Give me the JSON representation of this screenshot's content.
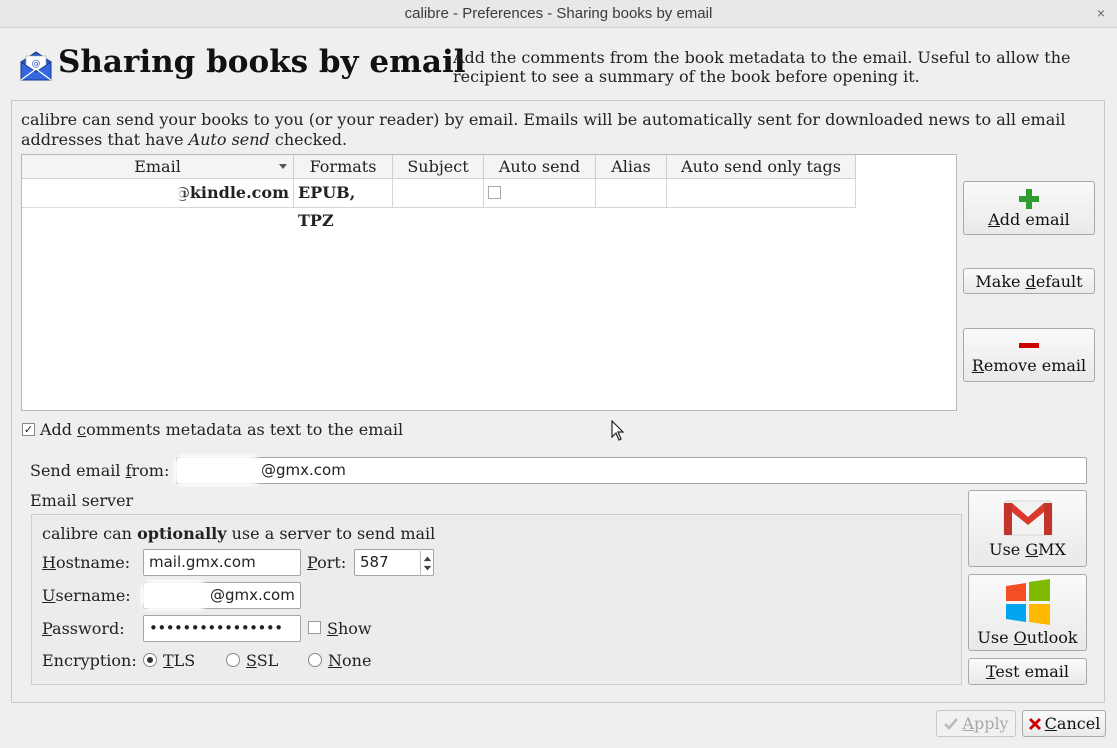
{
  "window": {
    "title": "calibre - Preferences - Sharing books by email",
    "close_glyph": "×"
  },
  "header": {
    "icon": "envelope-at-icon",
    "title": "Sharing books by email",
    "description": "Add the comments from the book metadata to the email. Useful to allow the recipient to see a summary of the book before opening it."
  },
  "intro": {
    "text_before": "calibre can send your books to you (or your reader) by email. Emails will be automatically sent for downloaded news to all email addresses that have ",
    "italic": "Auto send",
    "text_after": " checked."
  },
  "table": {
    "columns": [
      "Email",
      "Formats",
      "Subject",
      "Auto send",
      "Alias",
      "Auto send only tags"
    ],
    "rows": [
      {
        "email": "@kindle.com",
        "formats": "EPUB, TPZ",
        "subject": "",
        "auto_send": false,
        "alias": "",
        "tags": ""
      }
    ]
  },
  "side_buttons": {
    "add_email": {
      "icon": "plus-icon",
      "mnemonic": "A",
      "rest": "dd email"
    },
    "make_default": {
      "before": "Make ",
      "mnemonic": "d",
      "after": "efault"
    },
    "remove_email": {
      "icon": "minus-icon",
      "mnemonic": "R",
      "rest": "emove email"
    }
  },
  "comments_option": {
    "checked": true,
    "check_glyph": "✓",
    "before": "Add ",
    "mnemonic": "c",
    "after": "omments metadata as text to the email"
  },
  "send_from": {
    "label_before": "Send email ",
    "label_mnemonic": "f",
    "label_after": "rom:",
    "value": "@gmx.com"
  },
  "server": {
    "group_label": "Email server",
    "optional_before": "calibre can ",
    "optional_bold": "optionally",
    "optional_after": " use a server to send mail",
    "hostname_mnemonic": "H",
    "hostname_rest": "ostname:",
    "hostname_value": "mail.gmx.com",
    "port_mnemonic": "P",
    "port_rest": "ort:",
    "port_value": "587",
    "username_mnemonic": "U",
    "username_rest": "sername:",
    "username_value": "@gmx.com",
    "password_mnemonic": "P",
    "password_rest": "assword:",
    "password_value": "••••••••••••••••",
    "show_mnemonic": "S",
    "show_rest": "how",
    "show_checked": false,
    "encryption_label": "Encryption:",
    "tls_mnemonic": "T",
    "tls_rest": "LS",
    "ssl_mnemonic": "S",
    "ssl_rest": "SL",
    "none_mnemonic": "N",
    "none_rest": "one",
    "selected": "TLS"
  },
  "provider_buttons": {
    "gmx": {
      "icon": "gmail-m-icon",
      "before": "Use ",
      "mnemonic": "G",
      "after": "MX"
    },
    "outlook": {
      "icon": "windows-logo-icon",
      "before": "Use ",
      "mnemonic": "O",
      "after": "utlook"
    },
    "test": {
      "mnemonic": "T",
      "rest": "est email"
    }
  },
  "footer": {
    "apply": {
      "icon": "check-icon",
      "mnemonic": "A",
      "rest": "pply",
      "enabled": false
    },
    "cancel": {
      "icon": "x-icon",
      "mnemonic": "C",
      "rest": "ancel"
    }
  },
  "colors": {
    "add_green": "#2e9c2e",
    "remove_red": "#cc0000",
    "gmail_red": "#d93a2b",
    "accent_blue": "#2f5fd0"
  }
}
